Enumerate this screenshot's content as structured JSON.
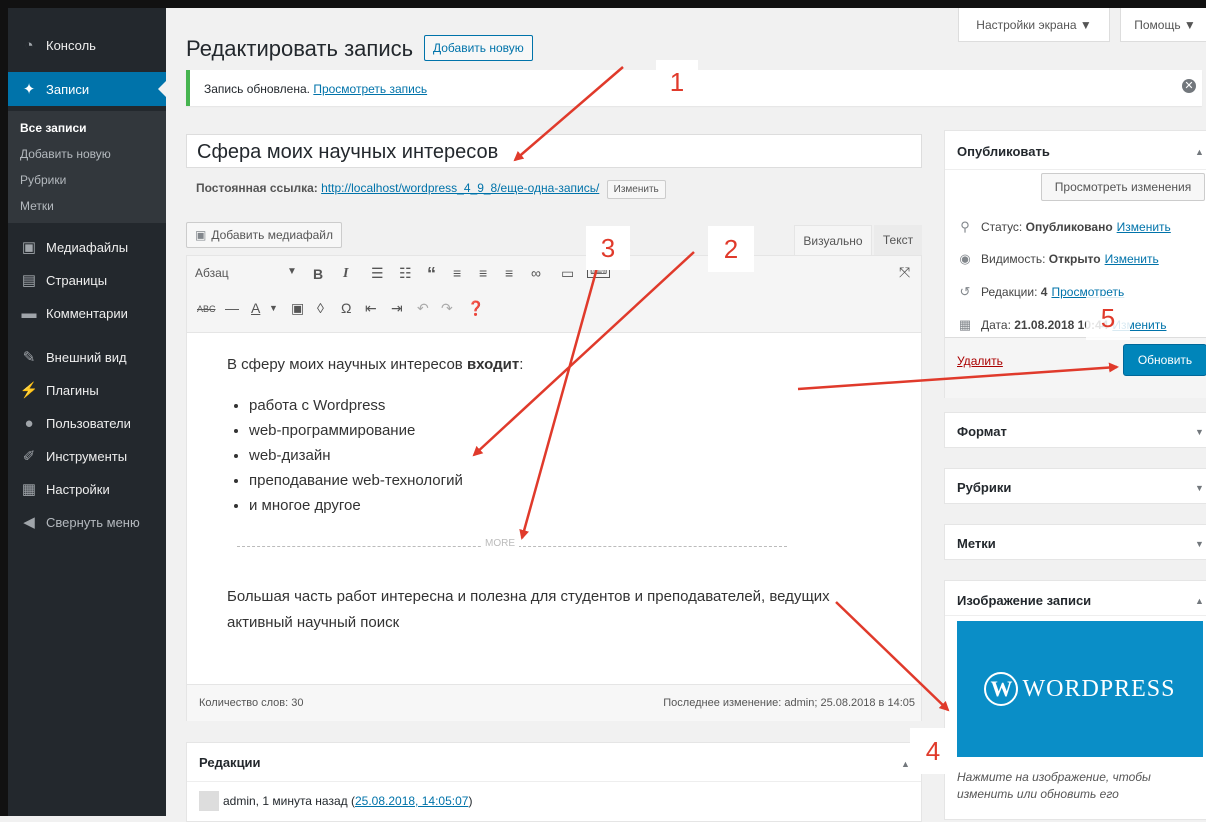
{
  "sidebar": {
    "items": [
      {
        "icon": "dashboard-icon",
        "label": "Консоль"
      },
      {
        "icon": "pin-icon",
        "label": "Записи"
      },
      {
        "icon": "media-icon",
        "label": "Медиафайлы"
      },
      {
        "icon": "pages-icon",
        "label": "Страницы"
      },
      {
        "icon": "comments-icon",
        "label": "Комментарии"
      },
      {
        "icon": "appearance-icon",
        "label": "Внешний вид"
      },
      {
        "icon": "plugins-icon",
        "label": "Плагины"
      },
      {
        "icon": "users-icon",
        "label": "Пользователи"
      },
      {
        "icon": "tools-icon",
        "label": "Инструменты"
      },
      {
        "icon": "settings-icon",
        "label": "Настройки"
      },
      {
        "icon": "collapse-icon",
        "label": "Свернуть меню"
      }
    ],
    "submenu": [
      "Все записи",
      "Добавить новую",
      "Рубрики",
      "Метки"
    ]
  },
  "top": {
    "screen_options": "Настройки экрана ▼",
    "help": "Помощь ▼"
  },
  "header": {
    "title": "Редактировать запись",
    "add_new": "Добавить новую"
  },
  "notice": {
    "text": "Запись обновлена.",
    "link": "Просмотреть запись"
  },
  "post": {
    "title": "Сфера моих научных интересов",
    "permalink_label": "Постоянная ссылка:",
    "permalink_url": "http://localhost/wordpress_4_9_8/еще-одна-запись/",
    "permalink_edit": "Изменить",
    "add_media": "Добавить медиафайл",
    "tab_visual": "Визуально",
    "tab_text": "Текст",
    "format": "Абзац",
    "intro": "В сферу моих научных интересов",
    "intro_bold": "входит",
    "intro_end": ":",
    "list": [
      "работа с Wordpress",
      "web-программирование",
      "web-дизайн",
      "преподавание web-технологий",
      "и многое другое"
    ],
    "more_label": "MORE",
    "para2": "Большая часть работ интересна и полезна для студентов и преподавателей, ведущих активный научный поиск",
    "word_count": "Количество слов: 30",
    "last_edit": "Последнее изменение: admin; 25.08.2018 в 14:05"
  },
  "revisions": {
    "title": "Редакции",
    "entry": "admin, 1 минута назад",
    "entry_link": "25.08.2018, 14:05:07"
  },
  "publish": {
    "title": "Опубликовать",
    "preview": "Просмотреть изменения",
    "status_label": "Статус:",
    "status_value": "Опубликовано",
    "status_edit": "Изменить",
    "visibility_label": "Видимость:",
    "visibility_value": "Открыто",
    "visibility_edit": "Изменить",
    "revisions_label": "Редакции:",
    "revisions_value": "4",
    "revisions_link": "Просмотреть",
    "date_label": "Дата:",
    "date_value": "21.08.2018 10:44",
    "date_edit": "Изменить",
    "trash": "Удалить",
    "update": "Обновить"
  },
  "boxes": {
    "format": "Формат",
    "categories": "Рубрики",
    "tags": "Метки",
    "featured": "Изображение записи",
    "featured_hint": "Нажмите на изображение, чтобы изменить или обновить его",
    "wp_logo_text": "WORDPRESS"
  },
  "annotations": [
    "1",
    "2",
    "3",
    "4",
    "5"
  ],
  "colors": {
    "accent": "#0073aa",
    "sidebar": "#23282d",
    "annotation": "#e03a2b",
    "update_button": "#0085ba",
    "notice_border": "#46b450"
  }
}
